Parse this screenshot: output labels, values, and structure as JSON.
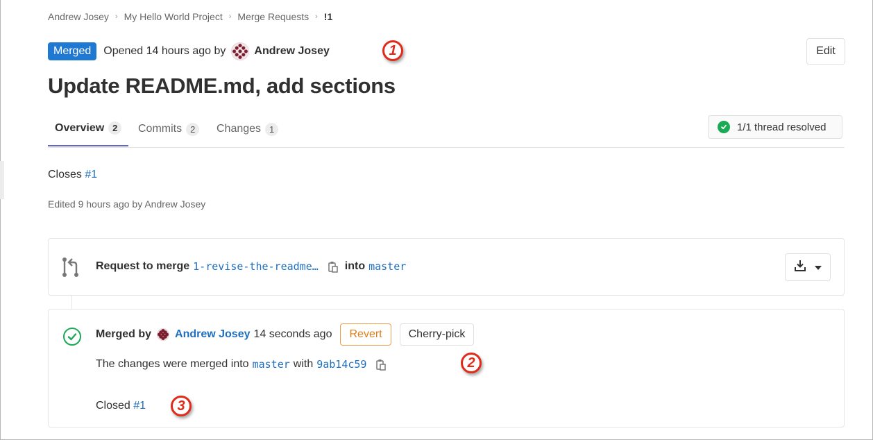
{
  "breadcrumb": [
    {
      "label": "Andrew Josey"
    },
    {
      "label": "My Hello World Project"
    },
    {
      "label": "Merge Requests"
    },
    {
      "label": "!1"
    }
  ],
  "header": {
    "status_badge": "Merged",
    "opened_text": "Opened 14 hours ago by",
    "author": "Andrew Josey",
    "edit_label": "Edit",
    "title": "Update README.md, add sections"
  },
  "annotations": [
    "1",
    "2",
    "3"
  ],
  "tabs": [
    {
      "label": "Overview",
      "count": "2",
      "active": true
    },
    {
      "label": "Commits",
      "count": "2",
      "active": false
    },
    {
      "label": "Changes",
      "count": "1",
      "active": false
    }
  ],
  "thread_status": "1/1 thread resolved",
  "description": {
    "closes_prefix": "Closes",
    "closes_link": "#1",
    "edited_text": "Edited 9 hours ago by Andrew Josey"
  },
  "merge_request_widget": {
    "prefix": "Request to merge",
    "source_branch": "1-revise-the-readme…",
    "into": "into",
    "target_branch": "master"
  },
  "merged_widget": {
    "merged_by": "Merged by",
    "author": "Andrew Josey",
    "time": "14 seconds ago",
    "revert_label": "Revert",
    "cherry_pick_label": "Cherry-pick",
    "changes_prefix": "The changes were merged into",
    "target_branch": "master",
    "with": "with",
    "commit_sha": "9ab14c59",
    "closed_prefix": "Closed",
    "closed_link": "#1"
  },
  "colors": {
    "merged_badge": "#1f78d1",
    "link": "#1f6fbf",
    "active_tab": "#6666c4",
    "success": "#1aaa55",
    "revert": "#e07d1b",
    "annotation": "#e02a1a"
  }
}
